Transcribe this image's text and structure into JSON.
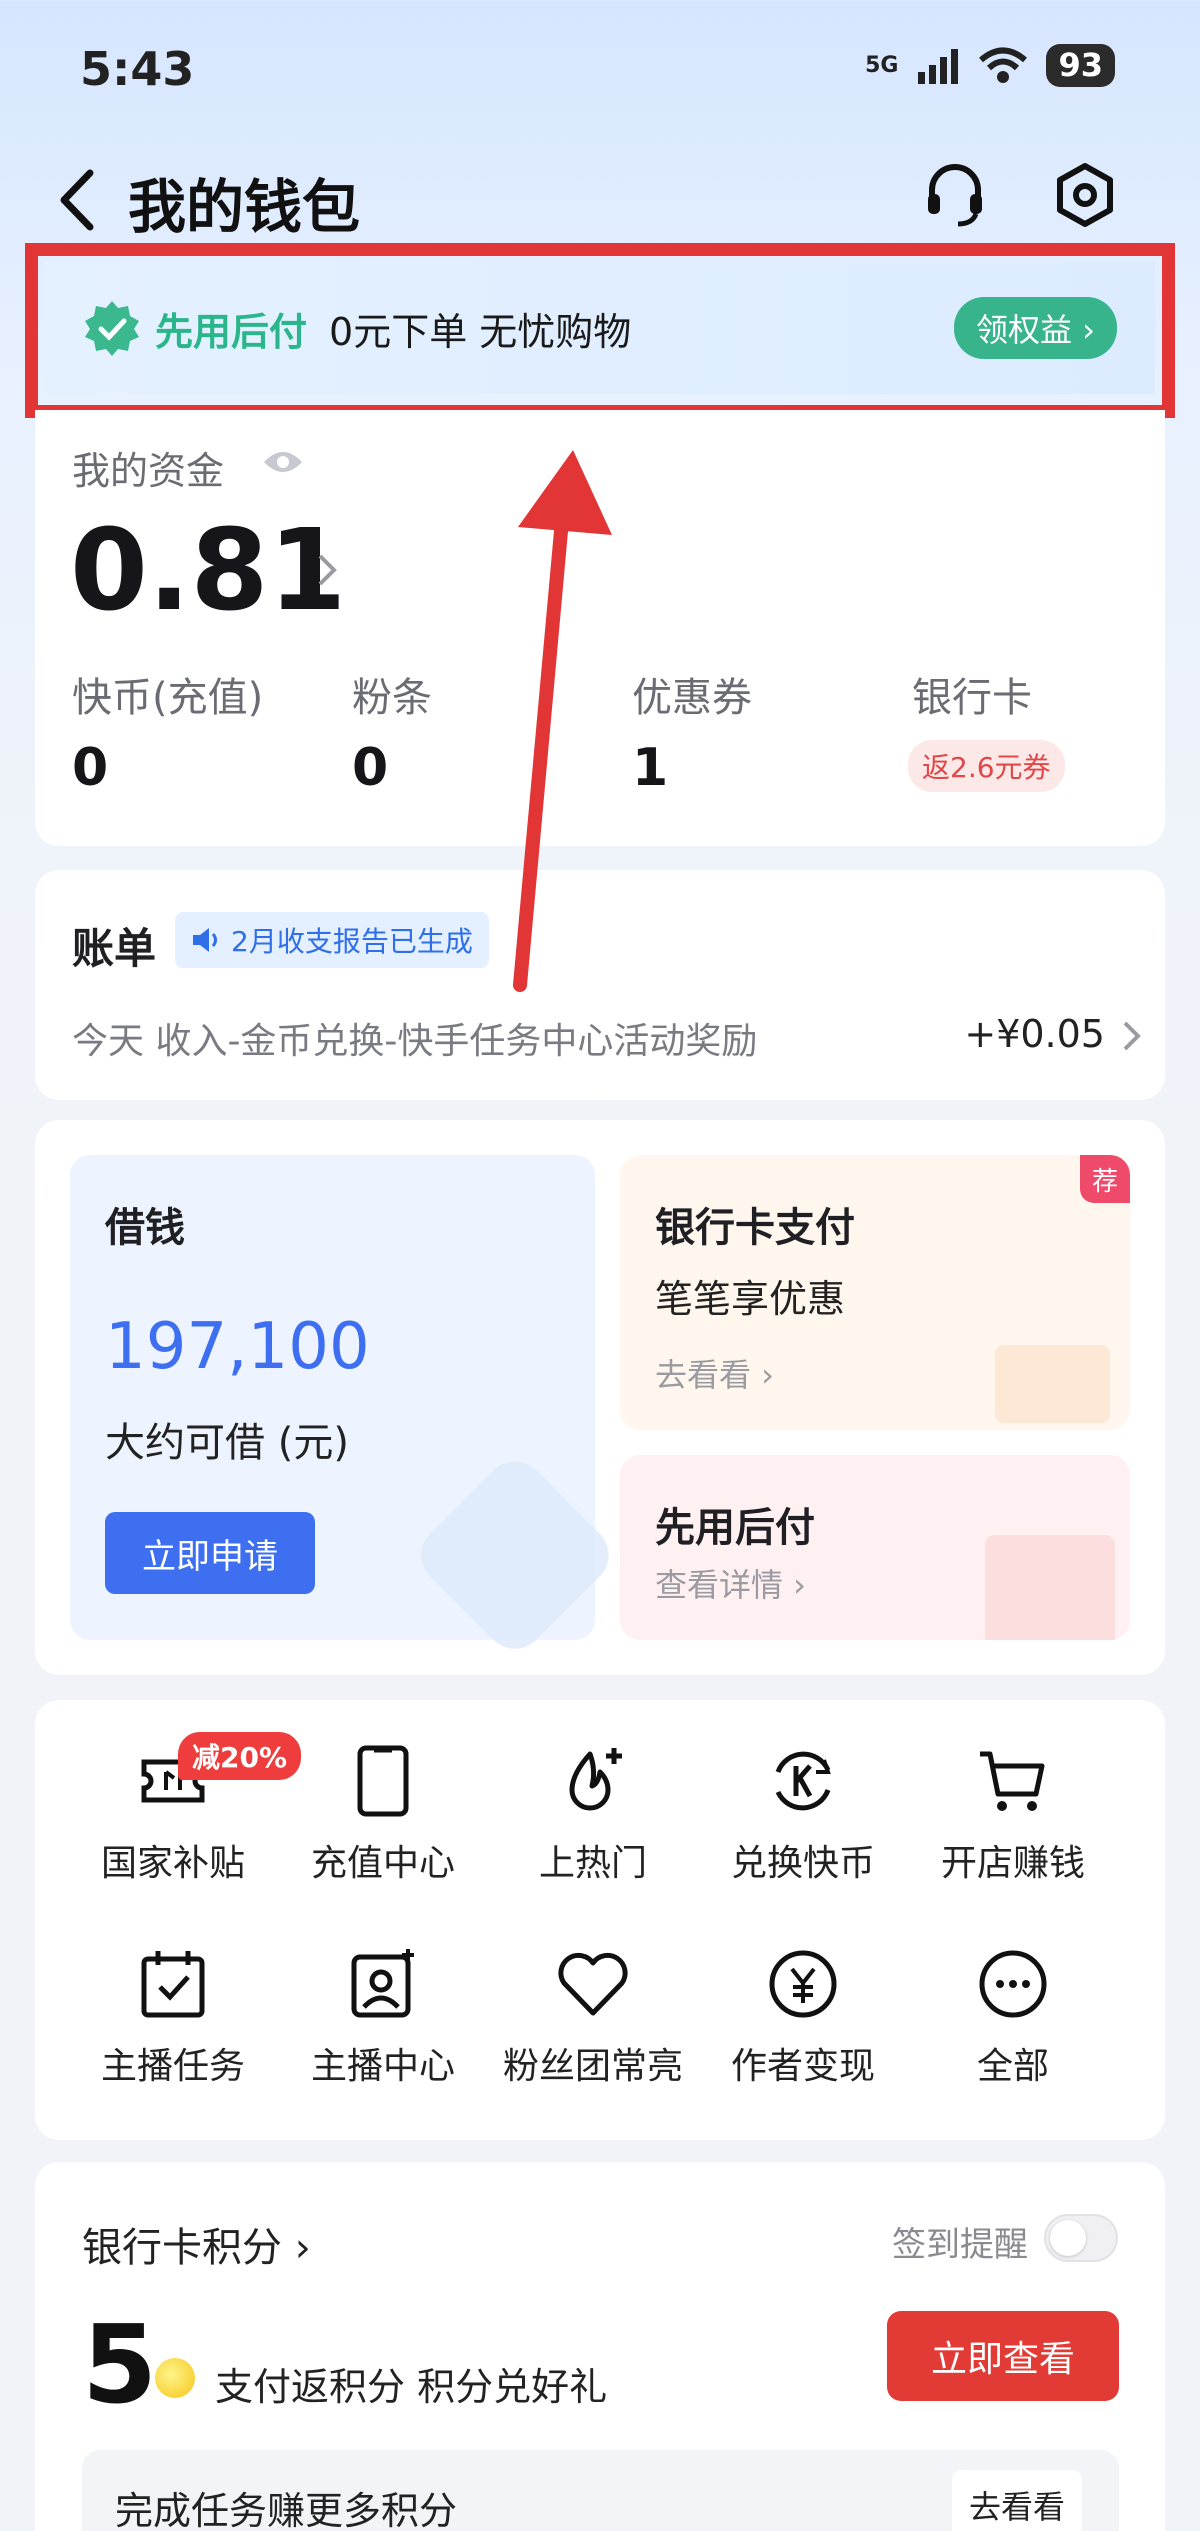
{
  "status_bar": {
    "time": "5:43",
    "network": "5G",
    "battery": "93"
  },
  "header": {
    "title": "我的钱包",
    "back_icon": "chevron-left-icon",
    "service_icon": "headset-icon",
    "settings_icon": "settings-hexagon-icon"
  },
  "banner": {
    "brand": "先用后付",
    "text": "0元下单 无忧购物",
    "button": "领权益 ›"
  },
  "funds": {
    "label": "我的资金",
    "balance": "0.81",
    "stats": [
      {
        "label": "快币(充值)",
        "value": "0"
      },
      {
        "label": "粉条",
        "value": "0"
      },
      {
        "label": "优惠券",
        "value": "1"
      },
      {
        "label": "银行卡",
        "promo": "返2.6元券"
      }
    ]
  },
  "bill": {
    "title": "账单",
    "tag": "2月收支报告已生成",
    "row_text": "今天  收入-金币兑换-快手任务中心活动奖励",
    "amount": "+¥0.05"
  },
  "services": {
    "loan": {
      "title": "借钱",
      "amount": "197,100",
      "subtitle": "大约可借 (元)",
      "button": "立即申请"
    },
    "card_pay": {
      "title": "银行卡支付",
      "subtitle": "笔笔享优惠",
      "link": "去看看 ›",
      "badge": "荐"
    },
    "bnpl": {
      "title": "先用后付",
      "link": "查看详情 ›"
    }
  },
  "grid": {
    "discount_badge": "减20%",
    "items": [
      {
        "label": "国家补贴",
        "icon": "ticket-icon"
      },
      {
        "label": "充值中心",
        "icon": "phone-icon"
      },
      {
        "label": "上热门",
        "icon": "flame-plus-icon"
      },
      {
        "label": "兑换快币",
        "icon": "exchange-k-icon"
      },
      {
        "label": "开店赚钱",
        "icon": "cart-icon"
      },
      {
        "label": "主播任务",
        "icon": "calendar-check-icon"
      },
      {
        "label": "主播中心",
        "icon": "user-card-icon"
      },
      {
        "label": "粉丝团常亮",
        "icon": "heart-icon"
      },
      {
        "label": "作者变现",
        "icon": "yuan-circle-icon"
      },
      {
        "label": "全部",
        "icon": "more-circle-icon"
      }
    ]
  },
  "points": {
    "title": "银行卡积分 ›",
    "remind": "签到提醒",
    "remind_on": false,
    "value": "5",
    "subtitle": "支付返积分 积分兑好礼",
    "button": "立即查看",
    "task_text": "完成任务赚更多积分",
    "task_button": "去看看"
  },
  "colors": {
    "accent_blue": "#3d6ff0",
    "brand_green": "#38b48d",
    "alert_red": "#e23535"
  }
}
